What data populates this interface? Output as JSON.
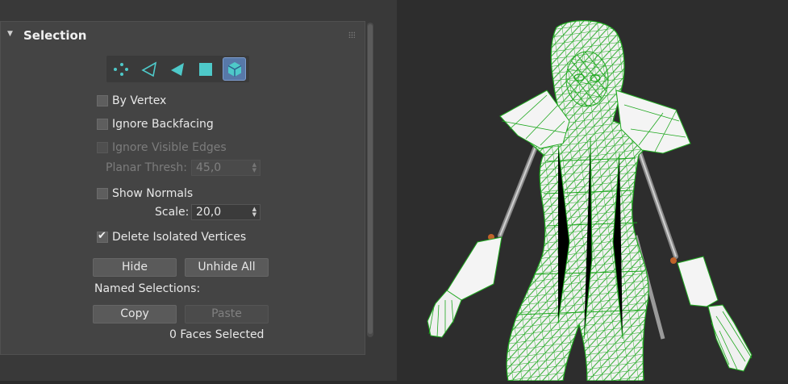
{
  "rollout": {
    "title": "Selection"
  },
  "subobject_modes": [
    {
      "name": "vertex-mode",
      "icon": "vertex-dots-icon",
      "active": false
    },
    {
      "name": "edge-mode",
      "icon": "edge-outline-triangle-icon",
      "active": false
    },
    {
      "name": "face-mode",
      "icon": "face-filled-triangle-icon",
      "active": false
    },
    {
      "name": "polygon-mode",
      "icon": "polygon-square-icon",
      "active": false
    },
    {
      "name": "element-mode",
      "icon": "element-cube-icon",
      "active": true
    }
  ],
  "options": {
    "by_vertex": {
      "label": "By Vertex",
      "checked": false
    },
    "ignore_backfacing": {
      "label": "Ignore Backfacing",
      "checked": false
    },
    "ignore_visible_edges": {
      "label": "Ignore Visible Edges",
      "checked": false,
      "enabled": false
    },
    "planar_thresh": {
      "label": "Planar Thresh:",
      "value": "45,0",
      "enabled": false
    },
    "show_normals": {
      "label": "Show Normals",
      "checked": false
    },
    "scale": {
      "label": "Scale:",
      "value": "20,0"
    },
    "delete_isolated_vertices": {
      "label": "Delete Isolated Vertices",
      "checked": true
    }
  },
  "buttons": {
    "hide": "Hide",
    "unhide_all": "Unhide All",
    "copy": "Copy",
    "paste": "Paste"
  },
  "named_selections_label": "Named Selections:",
  "status": "0 Faces Selected",
  "colors": {
    "accent": "#4ec9c9",
    "active_mode_bg": "#5778a8",
    "wire": "#1fa81f",
    "viewport_bg": "#2d2d2d",
    "panel_bg": "#444444"
  }
}
